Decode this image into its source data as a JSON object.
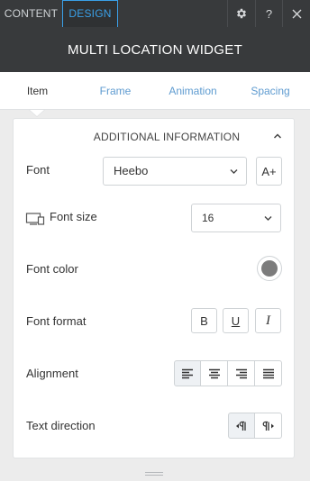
{
  "tabs": {
    "content": "CONTENT",
    "design": "DESIGN"
  },
  "toolbar": {
    "gear_icon": "gear-icon",
    "help": "?",
    "close": "✕"
  },
  "title": "MULTI LOCATION WIDGET",
  "subtabs": {
    "item": "Item",
    "frame": "Frame",
    "animation": "Animation",
    "spacing": "Spacing"
  },
  "section": {
    "title": "ADDITIONAL INFORMATION",
    "font": {
      "label": "Font",
      "value": "Heebo",
      "add_icon": "A+"
    },
    "font_size": {
      "label": "Font size",
      "value": "16"
    },
    "font_color": {
      "label": "Font color",
      "value": "#7c7c7c"
    },
    "font_format": {
      "label": "Font format",
      "bold": "B",
      "underline": "U",
      "italic": "I"
    },
    "alignment": {
      "label": "Alignment",
      "selected": "left"
    },
    "text_direction": {
      "label": "Text direction",
      "selected": "ltr"
    }
  },
  "colors": {
    "dark": "#383a3c",
    "accent": "#3aa0e8",
    "link": "#5e9bd0"
  }
}
